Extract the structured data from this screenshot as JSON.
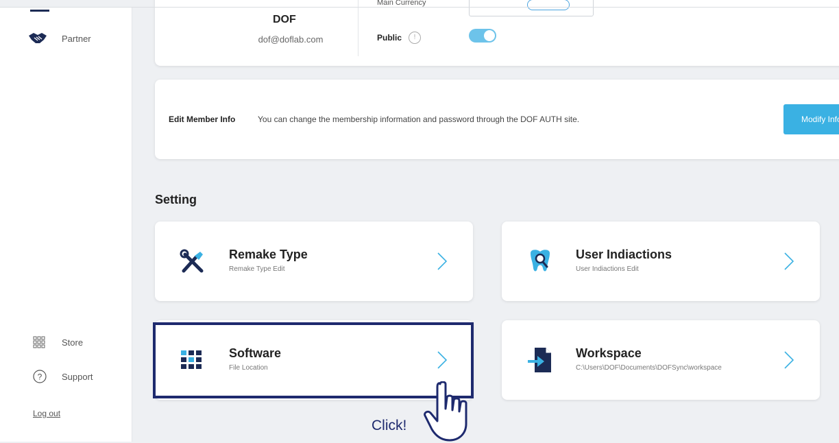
{
  "sidebar": {
    "partner_label": "Partner",
    "store_label": "Store",
    "support_label": "Support",
    "logout_label": "Log out"
  },
  "profile": {
    "name": "DOF",
    "email": "dof@doflab.com",
    "currency_label": "Main Currency",
    "public_label": "Public",
    "public_enabled": true
  },
  "member_info": {
    "title": "Edit Member Info",
    "description": "You can change the membership information and password through the DOF AUTH site.",
    "button_label": "Modify Info"
  },
  "setting": {
    "section_title": "Setting",
    "cards": [
      {
        "title": "Remake Type",
        "subtitle": "Remake Type Edit",
        "icon": "tools-icon"
      },
      {
        "title": "User Indiactions",
        "subtitle": "User Indiactions Edit",
        "icon": "tooth-search-icon"
      },
      {
        "title": "Software",
        "subtitle": "File Location",
        "icon": "grid-icon"
      },
      {
        "title": "Workspace",
        "subtitle": "C:\\Users\\DOF\\Documents\\DOFSync\\workspace",
        "icon": "file-import-icon"
      }
    ]
  },
  "annotation": {
    "click_label": "Click!"
  },
  "colors": {
    "accent": "#3ab1e3",
    "highlight": "#1e2a6e",
    "toggle": "#6dc3ea",
    "icon_dark": "#1c2b55"
  }
}
